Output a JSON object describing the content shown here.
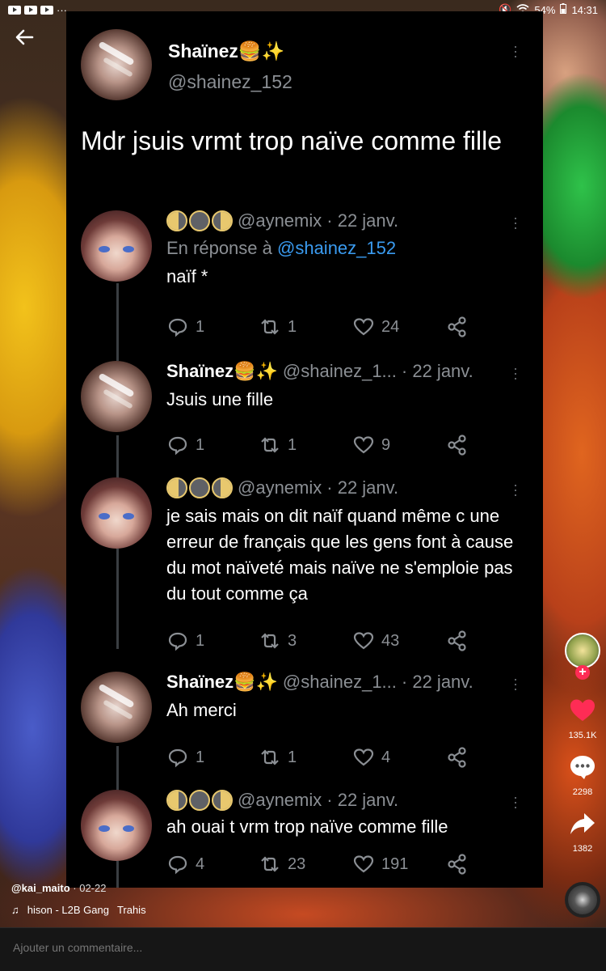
{
  "status_bar": {
    "battery": "54%",
    "time": "14:31",
    "dots": "···"
  },
  "main_tweet": {
    "author_name": "Shaïnez🍔✨",
    "author_handle": "@shainez_152",
    "text": "Mdr jsuis vrmt trop naïve comme fille"
  },
  "replies": [
    {
      "name": "",
      "moons": [
        "wax",
        "full",
        "wan"
      ],
      "handle": "@aynemix",
      "date": "· 22 janv.",
      "reply_to_label": "En réponse à",
      "reply_to_handle": "@shainez_152",
      "text": "naïf *",
      "replies": "1",
      "retweets": "1",
      "likes": "24"
    },
    {
      "name": "Shaïnez🍔✨",
      "handle": "@shainez_1...",
      "date": "· 22 janv.",
      "text": "Jsuis une fille",
      "replies": "1",
      "retweets": "1",
      "likes": "9"
    },
    {
      "name": "",
      "moons": [
        "wax",
        "full",
        "wan"
      ],
      "handle": "@aynemix",
      "date": "· 22 janv.",
      "text": "je sais mais on dit naïf quand même c une erreur de français que les gens font à cause du mot naïveté mais naïve ne s'emploie pas du tout comme ça",
      "replies": "1",
      "retweets": "3",
      "likes": "43"
    },
    {
      "name": "Shaïnez🍔✨",
      "handle": "@shainez_1...",
      "date": "· 22 janv.",
      "text": "Ah merci",
      "replies": "1",
      "retweets": "1",
      "likes": "4"
    },
    {
      "name": "",
      "moons": [
        "wax",
        "full",
        "wan"
      ],
      "handle": "@aynemix",
      "date": "· 22 janv.",
      "text": "ah ouai t vrm trop naïve comme fille",
      "replies": "4",
      "retweets": "23",
      "likes": "191"
    }
  ],
  "tiktok": {
    "likes": "135.1K",
    "comments": "2298",
    "shares": "1382",
    "username": "@kai_maito",
    "post_date": "· 02-22",
    "music_artist": "hison - L2B Gang",
    "music_title": "Trahis",
    "comment_placeholder": "Ajouter un commentaire..."
  },
  "colors": {
    "like_red": "#fe2c55",
    "link_blue": "#3a9bf0",
    "muted_gray": "#8b8f94"
  }
}
